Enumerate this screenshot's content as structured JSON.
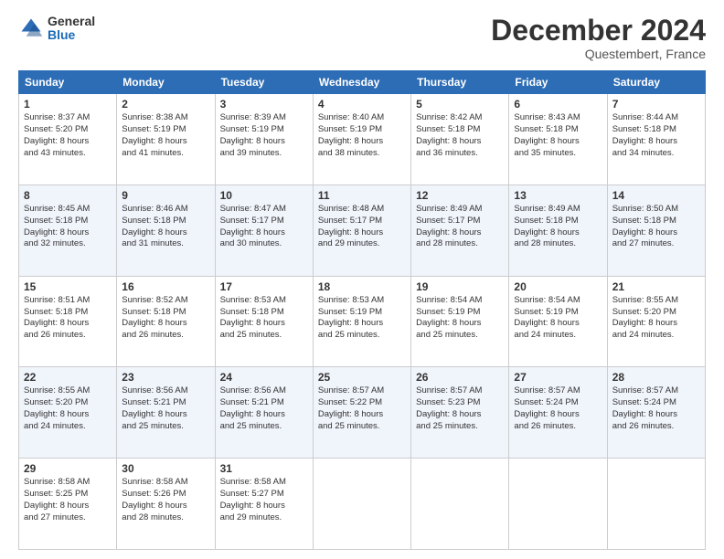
{
  "header": {
    "logo_general": "General",
    "logo_blue": "Blue",
    "month_title": "December 2024",
    "subtitle": "Questembert, France"
  },
  "days_of_week": [
    "Sunday",
    "Monday",
    "Tuesday",
    "Wednesday",
    "Thursday",
    "Friday",
    "Saturday"
  ],
  "weeks": [
    [
      {
        "day": "1",
        "lines": [
          "Sunrise: 8:37 AM",
          "Sunset: 5:20 PM",
          "Daylight: 8 hours",
          "and 43 minutes."
        ]
      },
      {
        "day": "2",
        "lines": [
          "Sunrise: 8:38 AM",
          "Sunset: 5:19 PM",
          "Daylight: 8 hours",
          "and 41 minutes."
        ]
      },
      {
        "day": "3",
        "lines": [
          "Sunrise: 8:39 AM",
          "Sunset: 5:19 PM",
          "Daylight: 8 hours",
          "and 39 minutes."
        ]
      },
      {
        "day": "4",
        "lines": [
          "Sunrise: 8:40 AM",
          "Sunset: 5:19 PM",
          "Daylight: 8 hours",
          "and 38 minutes."
        ]
      },
      {
        "day": "5",
        "lines": [
          "Sunrise: 8:42 AM",
          "Sunset: 5:18 PM",
          "Daylight: 8 hours",
          "and 36 minutes."
        ]
      },
      {
        "day": "6",
        "lines": [
          "Sunrise: 8:43 AM",
          "Sunset: 5:18 PM",
          "Daylight: 8 hours",
          "and 35 minutes."
        ]
      },
      {
        "day": "7",
        "lines": [
          "Sunrise: 8:44 AM",
          "Sunset: 5:18 PM",
          "Daylight: 8 hours",
          "and 34 minutes."
        ]
      }
    ],
    [
      {
        "day": "8",
        "lines": [
          "Sunrise: 8:45 AM",
          "Sunset: 5:18 PM",
          "Daylight: 8 hours",
          "and 32 minutes."
        ]
      },
      {
        "day": "9",
        "lines": [
          "Sunrise: 8:46 AM",
          "Sunset: 5:18 PM",
          "Daylight: 8 hours",
          "and 31 minutes."
        ]
      },
      {
        "day": "10",
        "lines": [
          "Sunrise: 8:47 AM",
          "Sunset: 5:17 PM",
          "Daylight: 8 hours",
          "and 30 minutes."
        ]
      },
      {
        "day": "11",
        "lines": [
          "Sunrise: 8:48 AM",
          "Sunset: 5:17 PM",
          "Daylight: 8 hours",
          "and 29 minutes."
        ]
      },
      {
        "day": "12",
        "lines": [
          "Sunrise: 8:49 AM",
          "Sunset: 5:17 PM",
          "Daylight: 8 hours",
          "and 28 minutes."
        ]
      },
      {
        "day": "13",
        "lines": [
          "Sunrise: 8:49 AM",
          "Sunset: 5:18 PM",
          "Daylight: 8 hours",
          "and 28 minutes."
        ]
      },
      {
        "day": "14",
        "lines": [
          "Sunrise: 8:50 AM",
          "Sunset: 5:18 PM",
          "Daylight: 8 hours",
          "and 27 minutes."
        ]
      }
    ],
    [
      {
        "day": "15",
        "lines": [
          "Sunrise: 8:51 AM",
          "Sunset: 5:18 PM",
          "Daylight: 8 hours",
          "and 26 minutes."
        ]
      },
      {
        "day": "16",
        "lines": [
          "Sunrise: 8:52 AM",
          "Sunset: 5:18 PM",
          "Daylight: 8 hours",
          "and 26 minutes."
        ]
      },
      {
        "day": "17",
        "lines": [
          "Sunrise: 8:53 AM",
          "Sunset: 5:18 PM",
          "Daylight: 8 hours",
          "and 25 minutes."
        ]
      },
      {
        "day": "18",
        "lines": [
          "Sunrise: 8:53 AM",
          "Sunset: 5:19 PM",
          "Daylight: 8 hours",
          "and 25 minutes."
        ]
      },
      {
        "day": "19",
        "lines": [
          "Sunrise: 8:54 AM",
          "Sunset: 5:19 PM",
          "Daylight: 8 hours",
          "and 25 minutes."
        ]
      },
      {
        "day": "20",
        "lines": [
          "Sunrise: 8:54 AM",
          "Sunset: 5:19 PM",
          "Daylight: 8 hours",
          "and 24 minutes."
        ]
      },
      {
        "day": "21",
        "lines": [
          "Sunrise: 8:55 AM",
          "Sunset: 5:20 PM",
          "Daylight: 8 hours",
          "and 24 minutes."
        ]
      }
    ],
    [
      {
        "day": "22",
        "lines": [
          "Sunrise: 8:55 AM",
          "Sunset: 5:20 PM",
          "Daylight: 8 hours",
          "and 24 minutes."
        ]
      },
      {
        "day": "23",
        "lines": [
          "Sunrise: 8:56 AM",
          "Sunset: 5:21 PM",
          "Daylight: 8 hours",
          "and 25 minutes."
        ]
      },
      {
        "day": "24",
        "lines": [
          "Sunrise: 8:56 AM",
          "Sunset: 5:21 PM",
          "Daylight: 8 hours",
          "and 25 minutes."
        ]
      },
      {
        "day": "25",
        "lines": [
          "Sunrise: 8:57 AM",
          "Sunset: 5:22 PM",
          "Daylight: 8 hours",
          "and 25 minutes."
        ]
      },
      {
        "day": "26",
        "lines": [
          "Sunrise: 8:57 AM",
          "Sunset: 5:23 PM",
          "Daylight: 8 hours",
          "and 25 minutes."
        ]
      },
      {
        "day": "27",
        "lines": [
          "Sunrise: 8:57 AM",
          "Sunset: 5:24 PM",
          "Daylight: 8 hours",
          "and 26 minutes."
        ]
      },
      {
        "day": "28",
        "lines": [
          "Sunrise: 8:57 AM",
          "Sunset: 5:24 PM",
          "Daylight: 8 hours",
          "and 26 minutes."
        ]
      }
    ],
    [
      {
        "day": "29",
        "lines": [
          "Sunrise: 8:58 AM",
          "Sunset: 5:25 PM",
          "Daylight: 8 hours",
          "and 27 minutes."
        ]
      },
      {
        "day": "30",
        "lines": [
          "Sunrise: 8:58 AM",
          "Sunset: 5:26 PM",
          "Daylight: 8 hours",
          "and 28 minutes."
        ]
      },
      {
        "day": "31",
        "lines": [
          "Sunrise: 8:58 AM",
          "Sunset: 5:27 PM",
          "Daylight: 8 hours",
          "and 29 minutes."
        ]
      },
      null,
      null,
      null,
      null
    ]
  ]
}
